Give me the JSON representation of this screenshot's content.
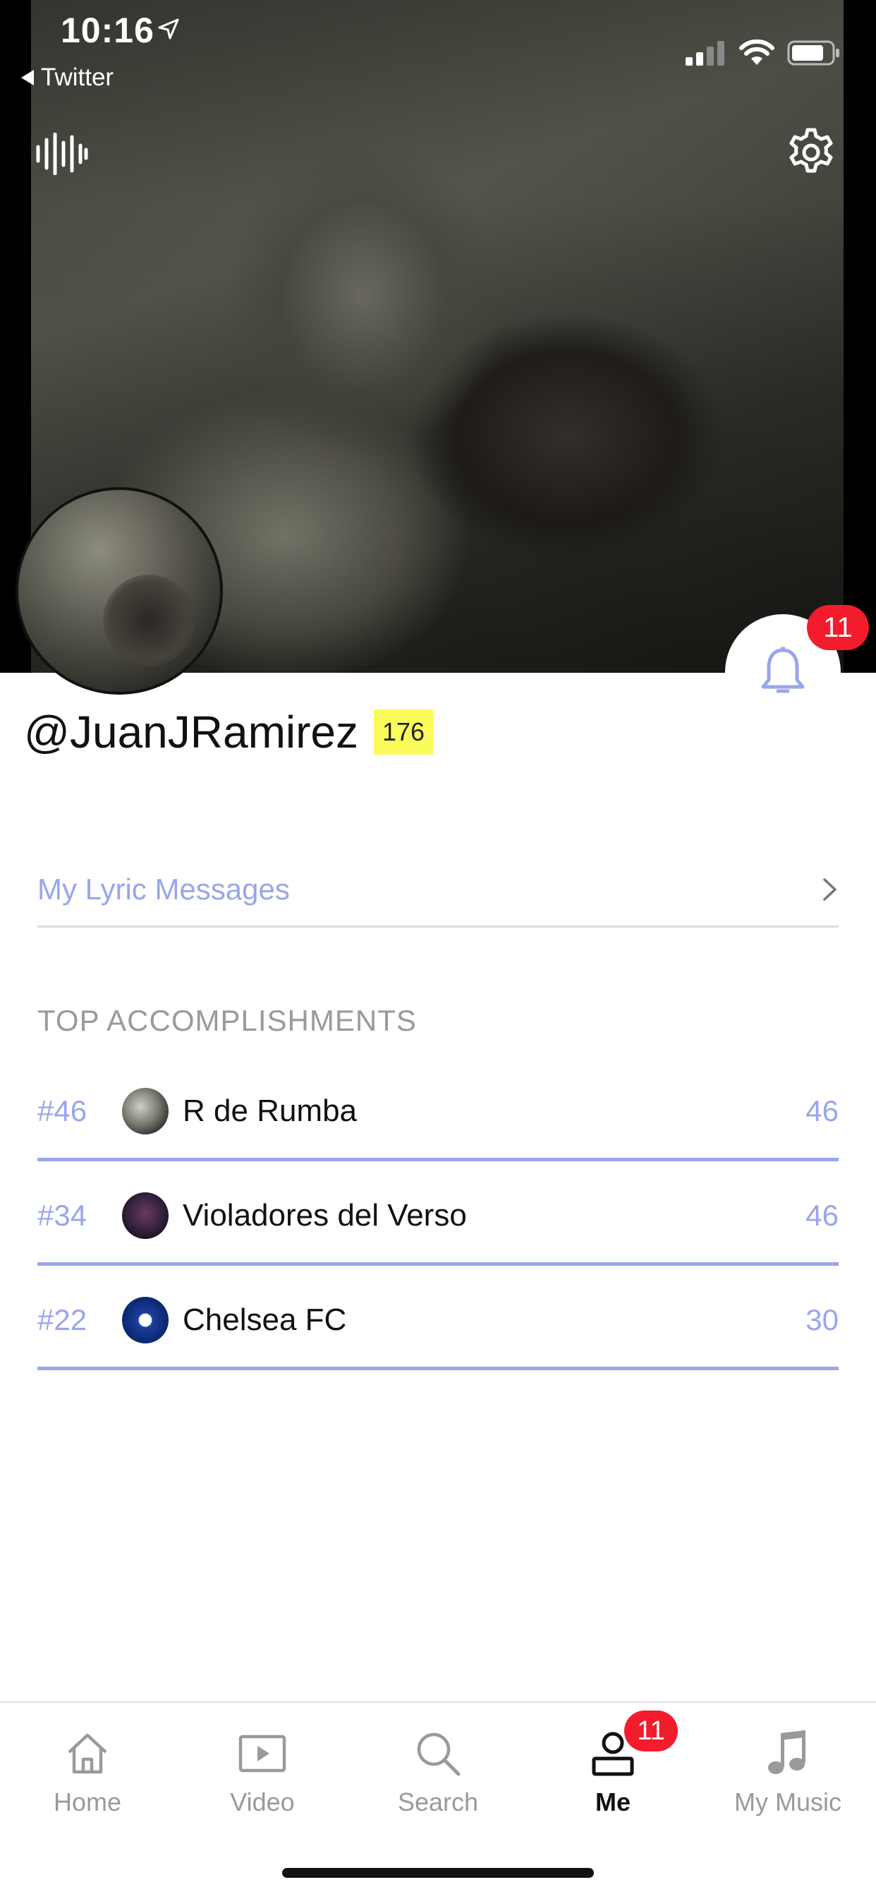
{
  "status_bar": {
    "time": "10:16",
    "back_app": "Twitter"
  },
  "profile": {
    "username": "@JuanJRamirez",
    "score": "176",
    "notification_count": "11"
  },
  "lyric_messages": {
    "label": "My Lyric Messages"
  },
  "accomplishments": {
    "title": "TOP ACCOMPLISHMENTS",
    "items": [
      {
        "rank": "#46",
        "name": "R de Rumba",
        "count": "46"
      },
      {
        "rank": "#34",
        "name": "Violadores del Verso",
        "count": "46"
      },
      {
        "rank": "#22",
        "name": "Chelsea FC",
        "count": "30"
      }
    ]
  },
  "tabbar": {
    "tabs": [
      {
        "label": "Home",
        "icon": "home-icon"
      },
      {
        "label": "Video",
        "icon": "video-icon"
      },
      {
        "label": "Search",
        "icon": "search-icon"
      },
      {
        "label": "Me",
        "icon": "person-icon",
        "active": true
      },
      {
        "label": "My Music",
        "icon": "music-note-icon"
      }
    ],
    "me_badge": "11"
  },
  "colors": {
    "accent": "#9aa6ea",
    "badge_red": "#f21c2c",
    "score_yellow": "#fbfb5a"
  }
}
